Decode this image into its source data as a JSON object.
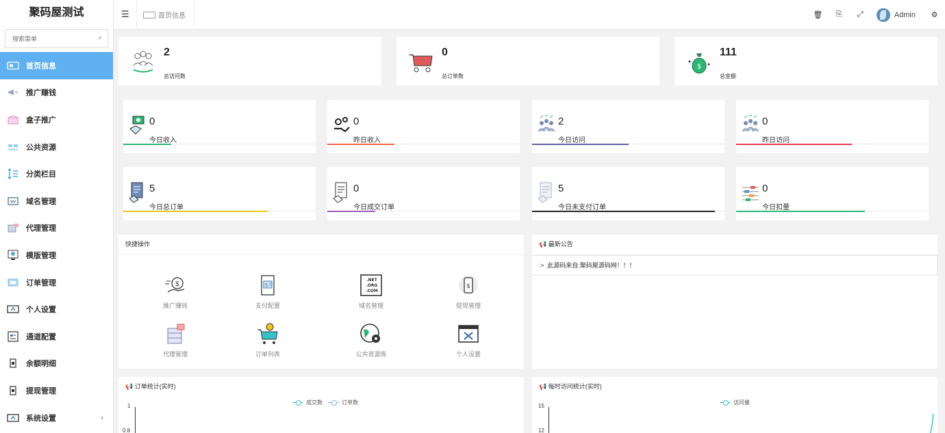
{
  "app": {
    "title": "聚码屋测试"
  },
  "search": {
    "placeholder": "搜索菜单"
  },
  "sidebar": {
    "items": [
      {
        "label": "首页信息",
        "icon": "home-card-icon",
        "active": true
      },
      {
        "label": "推广赚钱",
        "icon": "megaphone-icon"
      },
      {
        "label": "盒子推广",
        "icon": "box-icon"
      },
      {
        "label": "公共资源",
        "icon": "resource-icon"
      },
      {
        "label": "分类栏目",
        "icon": "sort-icon"
      },
      {
        "label": "域名管理",
        "icon": "domain-icon"
      },
      {
        "label": "代理管理",
        "icon": "agent-icon"
      },
      {
        "label": "模版管理",
        "icon": "template-icon"
      },
      {
        "label": "订单管理",
        "icon": "order-icon"
      },
      {
        "label": "个人设置",
        "icon": "person-settings-icon"
      },
      {
        "label": "通道配置",
        "icon": "channel-icon"
      },
      {
        "label": "余额明细",
        "icon": "balance-icon"
      },
      {
        "label": "提现管理",
        "icon": "withdraw-icon"
      },
      {
        "label": "系统设置",
        "icon": "system-settings-icon"
      }
    ],
    "collapse_glyph": "‹"
  },
  "header": {
    "tab_label": "首页信息",
    "user": "Admin"
  },
  "stats_big": [
    {
      "value": "2",
      "label": "总访问数",
      "icon": "visitors-icon"
    },
    {
      "value": "0",
      "label": "总订单数",
      "icon": "cart-icon"
    },
    {
      "value": "111",
      "label": "总金额",
      "icon": "money-bag-icon"
    }
  ],
  "stats_small": [
    {
      "value": "0",
      "label": "今日收入",
      "color": "#2bb673",
      "fill": 0.25
    },
    {
      "value": "0",
      "label": "昨日收入",
      "color": "#f0643c",
      "fill": 0.35
    },
    {
      "value": "2",
      "label": "今日访问",
      "color": "#5b5ea6",
      "fill": 0.5
    },
    {
      "value": "0",
      "label": "昨日访问",
      "color": "#e8344a",
      "fill": 0.6
    },
    {
      "value": "5",
      "label": "今日总订单",
      "color": "#f0c419",
      "fill": 0.75
    },
    {
      "value": "0",
      "label": "今日成交订单",
      "color": "#9b59b6",
      "fill": 0.25
    },
    {
      "value": "5",
      "label": "今日未支付订单",
      "color": "#222222",
      "fill": 0.95
    },
    {
      "value": "0",
      "label": "今日扣量",
      "color": "#2bb673",
      "fill": 0.67
    }
  ],
  "quick": {
    "title": "快捷操作",
    "items": [
      {
        "label": "推广赚钱"
      },
      {
        "label": "支付配置"
      },
      {
        "label": "域名管理"
      },
      {
        "label": "提现管理"
      },
      {
        "label": "代理管理"
      },
      {
        "label": "订单列表"
      },
      {
        "label": "公共资源库"
      },
      {
        "label": "个人设置"
      }
    ]
  },
  "notice": {
    "title": "最新公告",
    "items": [
      "此源码来自:聚码屋源码网！！！"
    ]
  },
  "charts": {
    "orders": {
      "title": "订单统计(实时)",
      "legend": [
        "成交数",
        "订单数"
      ],
      "ticks": [
        "1",
        "0.8"
      ]
    },
    "visits": {
      "title": "每时访问统计(实时)",
      "legend": [
        "访问量"
      ],
      "ticks": [
        "15",
        "12"
      ]
    }
  }
}
